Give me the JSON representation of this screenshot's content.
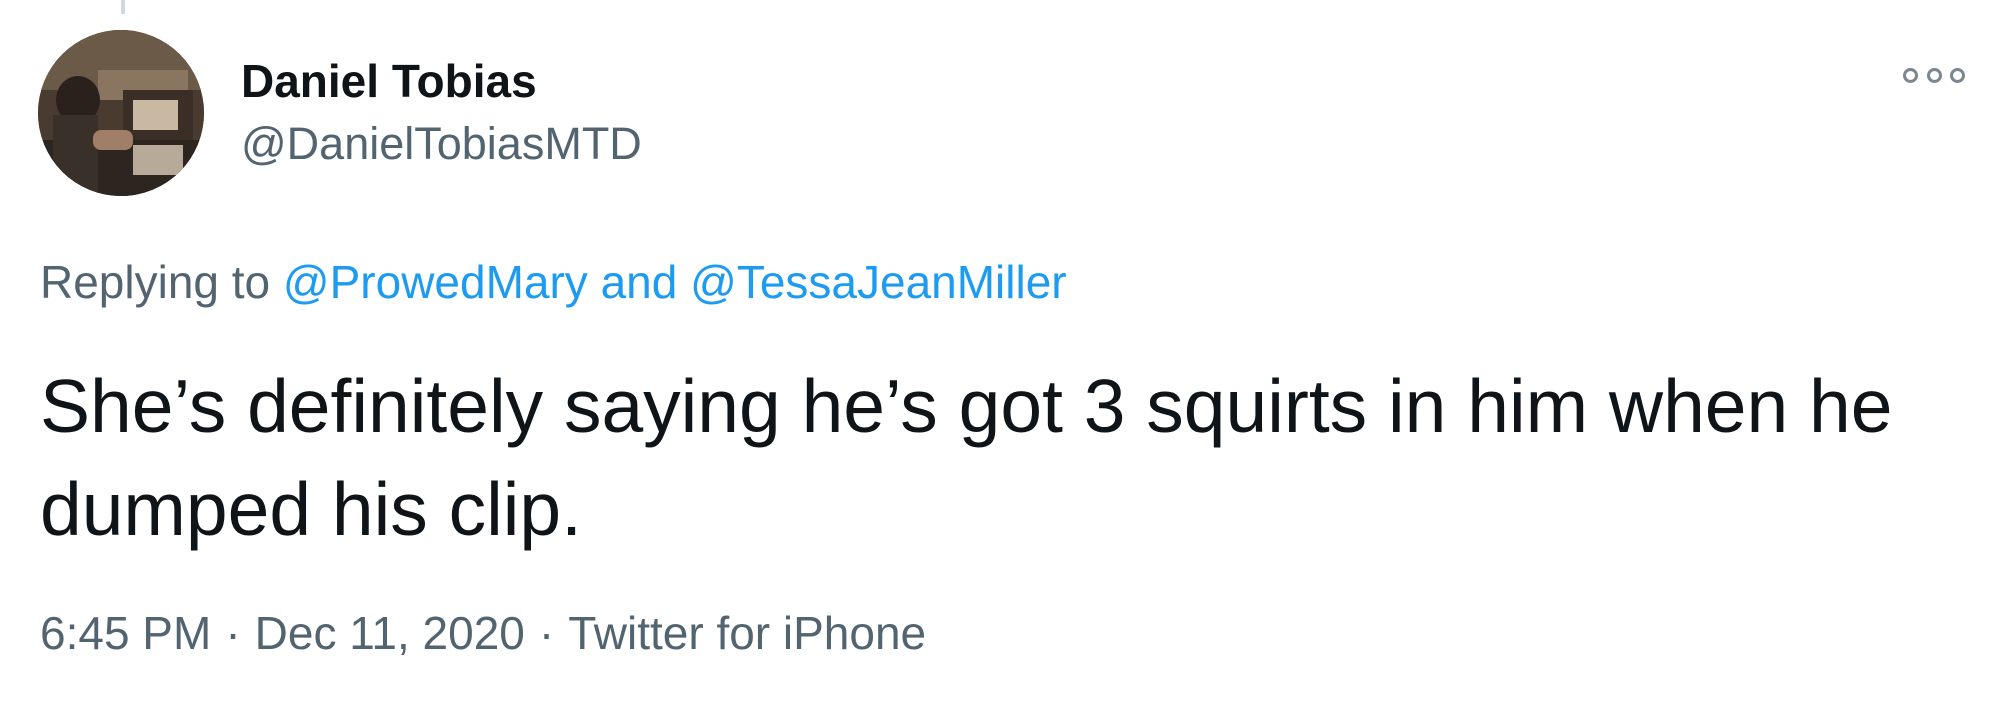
{
  "author": {
    "name": "Daniel Tobias",
    "handle": "@DanielTobiasMTD",
    "avatar_icon": "avatar-photo"
  },
  "reply": {
    "prefix": "Replying to",
    "mention_1": "@ProwedMary",
    "conjunction": "and",
    "mention_2": "@TessaJeanMiller"
  },
  "tweet": {
    "text": "She’s definitely saying he’s got 3 squirts in him when he dumped his clip."
  },
  "meta": {
    "time": "6:45 PM",
    "date": "Dec 11, 2020",
    "source": "Twitter for iPhone",
    "separator": "·"
  },
  "icons": {
    "more": "more-options-icon"
  },
  "colors": {
    "link": "#1d9bf0",
    "secondary_text": "#536471",
    "primary_text": "#0f1419"
  }
}
